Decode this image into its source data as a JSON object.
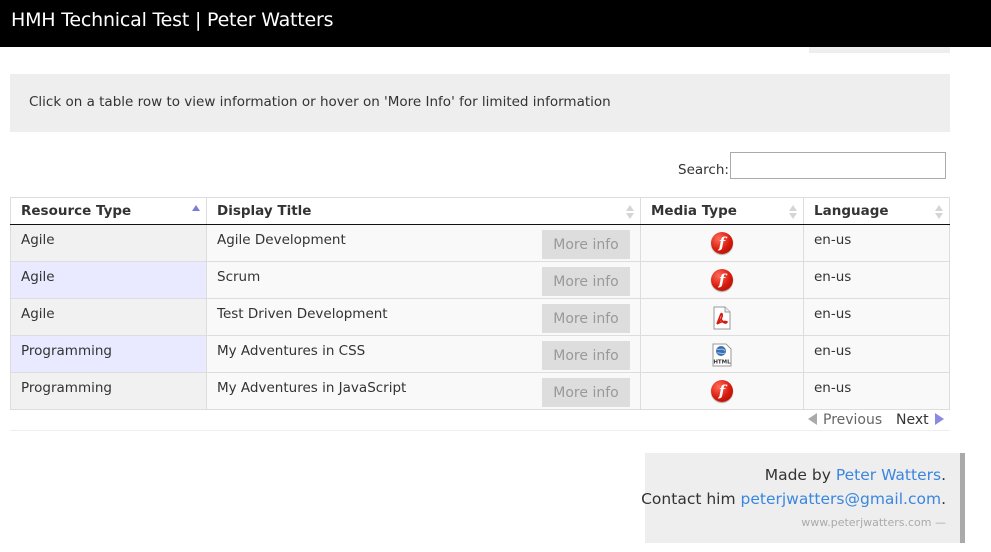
{
  "header": {
    "title": "HMH Technical Test | Peter Watters"
  },
  "info": {
    "text": "Click on a table row to view information or hover on 'More Info' for limited information"
  },
  "search": {
    "label": "Search:",
    "value": "",
    "placeholder": ""
  },
  "table": {
    "columns": [
      "Resource Type",
      "Display Title",
      "Media Type",
      "Language"
    ],
    "sorted_column": "Resource Type",
    "sort_direction": "asc",
    "more_info_label": "More info",
    "rows": [
      {
        "resource_type": "Agile",
        "display_title": "Agile Development",
        "media_icon": "flash-icon",
        "language": "en-us"
      },
      {
        "resource_type": "Agile",
        "display_title": "Scrum",
        "media_icon": "flash-icon",
        "language": "en-us"
      },
      {
        "resource_type": "Agile",
        "display_title": "Test Driven Development",
        "media_icon": "pdf-icon",
        "language": "en-us"
      },
      {
        "resource_type": "Programming",
        "display_title": "My Adventures in CSS",
        "media_icon": "html-icon",
        "language": "en-us"
      },
      {
        "resource_type": "Programming",
        "display_title": "My Adventures in JavaScript",
        "media_icon": "flash-icon",
        "language": "en-us"
      }
    ]
  },
  "pager": {
    "previous": "Previous",
    "next": "Next"
  },
  "footer": {
    "made_by_prefix": "Made by ",
    "made_by_name": "Peter Watters",
    "made_by_suffix": ".",
    "contact_prefix": "Contact him ",
    "contact_email": "peterjwatters@gmail.com",
    "contact_suffix": ".",
    "site": "www.peterjwatters.com —"
  },
  "colors": {
    "topbar": "#000000",
    "panel": "#eeeeee",
    "link": "#3a86e0",
    "sort_active": "#7b7bd8",
    "flash_red": "#d61a0c"
  }
}
